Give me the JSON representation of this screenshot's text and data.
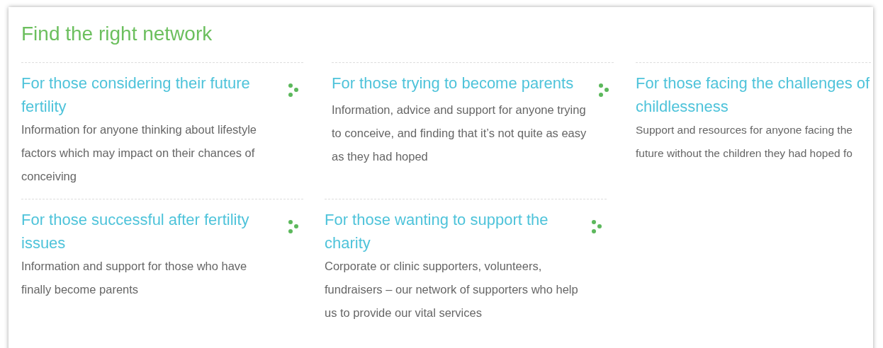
{
  "title": "Find the right network",
  "rows": [
    [
      {
        "heading": "For those considering their future fertility",
        "description": "Information for anyone thinking about lifestyle factors which may impact on their chances of conceiving",
        "dots": true
      },
      {
        "heading": "For those trying to become parents",
        "description": "Information, advice and support for anyone trying to conceive, and finding that it’s not quite as easy as they had hoped",
        "dots": true
      },
      {
        "heading": "For those facing the challenges of childlessness",
        "description": "Support and resources for anyone facing the future without the children they had hoped fo"
      }
    ],
    [
      {
        "heading": "For those successful after fertility issues",
        "description": "Information and support for those who have finally become parents",
        "dots": true
      },
      {
        "heading": "For those wanting to support the charity",
        "description": "Corporate or clinic supporters, volunteers, fundraisers – our network of supporters who help us to provide our vital services",
        "dots": true
      }
    ]
  ]
}
